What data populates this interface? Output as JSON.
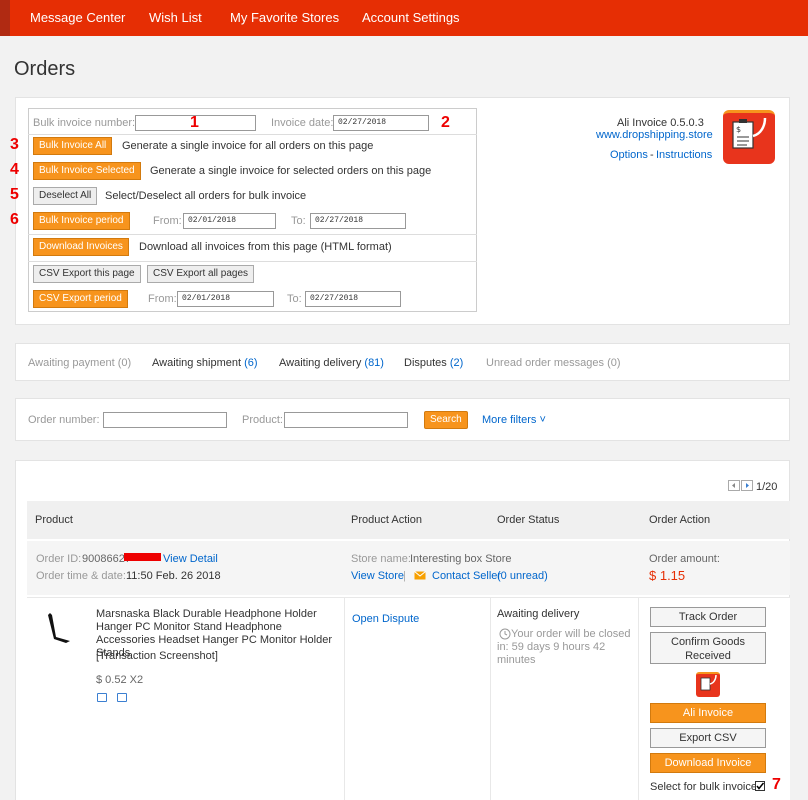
{
  "nav": {
    "items": [
      "Message Center",
      "Wish List",
      "My Favorite Stores",
      "Account Settings"
    ]
  },
  "page_title": "Orders",
  "ali_invoice": {
    "bulk_number_label": "Bulk invoice number:",
    "bulk_number_value": "",
    "invoice_date_label": "Invoice date:",
    "invoice_date_value": "02/27/2018",
    "bulk_all_btn": "Bulk Invoice All",
    "bulk_all_desc": "Generate a single invoice for all orders on this page",
    "bulk_selected_btn": "Bulk Invoice Selected",
    "bulk_selected_desc": "Generate a single invoice for selected orders on this page",
    "deselect_btn": "Deselect All",
    "deselect_desc": "Select/Deselect all orders for bulk invoice",
    "period_btn": "Bulk Invoice period",
    "from_label": "From:",
    "to_label": "To:",
    "period_from": "02/01/2018",
    "period_to": "02/27/2018",
    "download_btn": "Download Invoices",
    "download_desc": "Download all invoices from this page (HTML format)",
    "csv_page_btn": "CSV Export this page",
    "csv_all_btn": "CSV Export all pages",
    "csv_period_btn": "CSV Export period",
    "csv_from": "02/01/2018",
    "csv_to": "02/27/2018",
    "version": "Ali Invoice 0.5.0.3",
    "website": "www.dropshipping.store",
    "options": "Options",
    "dash": "-",
    "instructions": "Instructions",
    "annotations": [
      "1",
      "2",
      "3",
      "4",
      "5",
      "6",
      "7"
    ]
  },
  "tabs": [
    {
      "label": "Awaiting payment",
      "count": "(0)"
    },
    {
      "label": "Awaiting shipment",
      "count": "(6)"
    },
    {
      "label": "Awaiting delivery",
      "count": "(81)"
    },
    {
      "label": "Disputes",
      "count": "(2)"
    },
    {
      "label": "Unread order messages",
      "count": "(0)"
    }
  ],
  "filters": {
    "order_number_label": "Order number:",
    "product_label": "Product:",
    "search_btn": "Search",
    "more_filters": "More filters",
    "chevron": "˅"
  },
  "pagination": {
    "text": "1/20"
  },
  "table_headers": [
    "Product",
    "Product Action",
    "Order Status",
    "Order Action"
  ],
  "order": {
    "id_label": "Order ID:",
    "id_value": "90086627",
    "view_detail": "View Detail",
    "time_label": "Order time & date:",
    "time_value": "11:50 Feb. 26 2018",
    "store_label": "Store name:",
    "store_value": "Interesting box Store",
    "view_store": "View Store",
    "separator": "|",
    "contact_seller": "Contact Seller",
    "unread": "(0 unread)",
    "amount_label": "Order amount:",
    "amount_value": "$ 1.15",
    "product_title": "Marsnaska Black Durable Headphone Holder Hanger PC Monitor Stand Headphone Accessories Headset Hanger PC Monitor Holder Stands",
    "screenshot_tag": "[Transaction Screenshot]",
    "price": "$ 0.52 X2",
    "open_dispute": "Open Dispute",
    "status": "Awaiting delivery",
    "status_note": "Your order will be closed in: 59 days 9 hours 42 minutes",
    "track_btn": "Track Order",
    "confirm_btn": "Confirm Goods Received",
    "ali_invoice_btn": "Ali Invoice",
    "export_csv_btn": "Export CSV",
    "download_invoice_btn": "Download Invoice",
    "select_bulk_label": "Select for bulk invoice:"
  },
  "colors": {
    "brand": "#e62e04",
    "accent": "#f7941d",
    "link": "#0066cc",
    "price": "#e62e04"
  }
}
